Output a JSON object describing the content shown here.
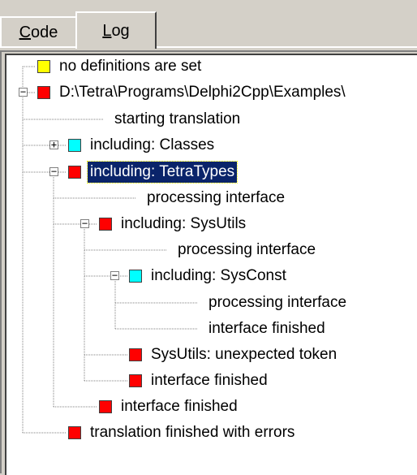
{
  "tabs": [
    {
      "label_hot": "C",
      "label_rest": "ode",
      "active": false
    },
    {
      "label_hot": "L",
      "label_rest": "og",
      "active": true
    }
  ],
  "colors": {
    "yellow": "#ffff00",
    "red": "#ff0000",
    "cyan": "#00ffff",
    "selection": "#0a246a"
  },
  "log": {
    "nodes": [
      {
        "text": "no definitions are set",
        "color_key": "yellow",
        "icon": "yellow-square-icon"
      },
      {
        "text": "D:\\Tetra\\Programs\\Delphi2Cpp\\Examples\\",
        "color_key": "red",
        "icon": "red-square-icon",
        "expander": "−"
      },
      {
        "text": "starting translation",
        "icon": ""
      },
      {
        "text": "including: Classes",
        "color_key": "cyan",
        "icon": "cyan-square-icon",
        "expander": "+"
      },
      {
        "text": "including: TetraTypes",
        "color_key": "red",
        "icon": "red-square-icon",
        "expander": "−",
        "selected": true
      },
      {
        "text": "processing interface",
        "icon": ""
      },
      {
        "text": "including: SysUtils",
        "color_key": "red",
        "icon": "red-square-icon",
        "expander": "−"
      },
      {
        "text": "processing interface",
        "icon": ""
      },
      {
        "text": "including: SysConst",
        "color_key": "cyan",
        "icon": "cyan-square-icon",
        "expander": "−"
      },
      {
        "text": "processing interface",
        "icon": ""
      },
      {
        "text": "interface finished",
        "icon": ""
      },
      {
        "text": "SysUtils: unexpected token",
        "color_key": "red",
        "icon": "red-square-icon"
      },
      {
        "text": "interface finished",
        "color_key": "red",
        "icon": "red-square-icon"
      },
      {
        "text": "interface finished",
        "color_key": "red",
        "icon": "red-square-icon"
      },
      {
        "text": "translation finished with errors",
        "color_key": "red",
        "icon": "red-square-icon"
      }
    ]
  }
}
